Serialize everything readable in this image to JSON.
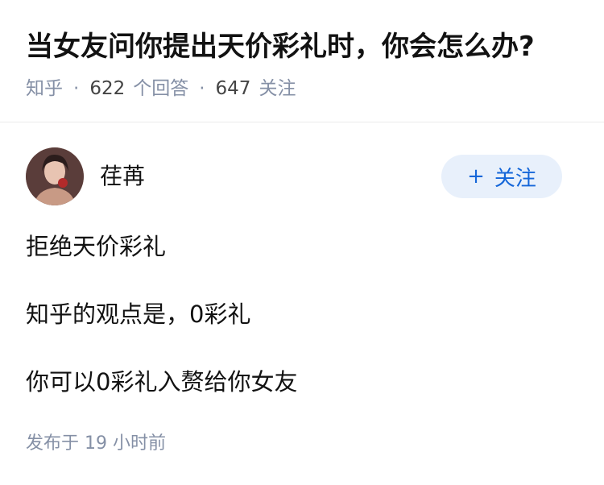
{
  "question": {
    "title": "当女友问你提出天价彩礼时，你会怎么办?",
    "source": "知乎",
    "answer_count": "622",
    "answer_label": "个回答",
    "follow_count": "647",
    "follow_label": "关注"
  },
  "answer": {
    "author": {
      "name": "荏苒",
      "avatar_icon": "avatar-photo"
    },
    "follow_button": {
      "icon": "plus-icon",
      "label": "关注"
    },
    "lines": [
      "拒绝天价彩礼",
      "知乎的观点是，0彩礼",
      "你可以0彩礼入赘给你女友"
    ],
    "publish_info": "发布于  19 小时前"
  },
  "colors": {
    "title": "#121212",
    "meta": "#8590a6",
    "follow_bg": "#e8f0fb",
    "follow_text": "#1466d9"
  }
}
